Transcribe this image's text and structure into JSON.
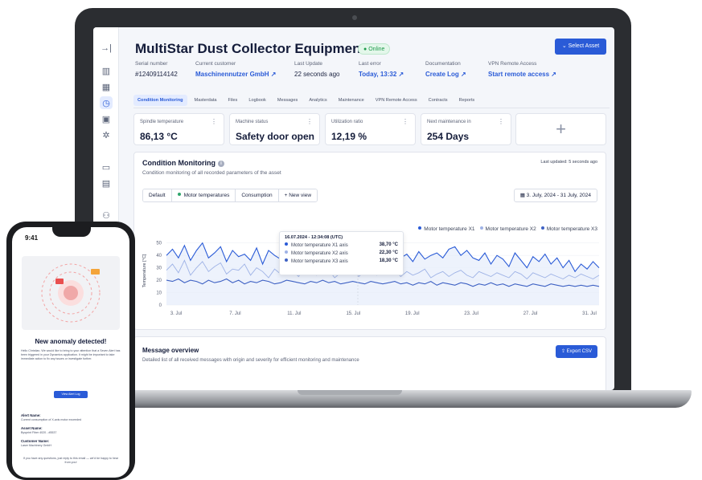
{
  "app": {
    "title": "MultiStar Dust Collector Equipment",
    "status_badge": "Online",
    "select_asset_label": "Select Asset",
    "colors": {
      "accent": "#2a5bd7",
      "online": "#1f9a4c",
      "series1": "#2a5bd7",
      "series2": "#9fb3e6",
      "series3": "#3f62c4"
    }
  },
  "sidebar": {
    "icons": [
      "collapse-icon",
      "dashboard-icon",
      "factory-icon",
      "monitoring-icon",
      "device-icon",
      "settings-icon",
      "folder-icon",
      "document-icon",
      "users-icon"
    ]
  },
  "meta": [
    {
      "label": "Serial number",
      "value": "#12409114142",
      "link": false
    },
    {
      "label": "Current customer",
      "value": "Maschinennutzer GmbH ↗",
      "link": true
    },
    {
      "label": "Last Update",
      "value": "22 seconds ago",
      "link": false
    },
    {
      "label": "Last error",
      "value": "Today, 13:32 ↗",
      "link": true
    },
    {
      "label": "Documentation",
      "value": "Create Log ↗",
      "link": true
    },
    {
      "label": "VPN Remote Access",
      "value": "Start remote access ↗",
      "link": true
    }
  ],
  "tabs": [
    "Condition Monitoring",
    "Masterdata",
    "Files",
    "Logbook",
    "Messages",
    "Analytics",
    "Maintenance",
    "VPN Remote Access",
    "Contracts",
    "Reports"
  ],
  "kpis": [
    {
      "label": "Spindle temperature",
      "value": "86,13 °C"
    },
    {
      "label": "Machine status",
      "value": "Safety door open"
    },
    {
      "label": "Utilization ratio",
      "value": "12,19 %"
    },
    {
      "label": "Next maintenance in",
      "value": "254 Days"
    }
  ],
  "kpi_add_label": "+",
  "condition": {
    "title": "Condition Monitoring",
    "subtitle": "Condition monitoring of all recorded parameters of the asset",
    "last_updated": "Last updated: 5 seconds ago",
    "views": [
      "Default",
      "Motor temperatures",
      "Consumption",
      "+ New view"
    ],
    "date_range": "3. July, 2024 - 31 July, 2024"
  },
  "tooltip": {
    "title": "16.07.2024 - 12:34:08 (UTC)",
    "rows": [
      {
        "label": "Motor temperature X1 axis",
        "value": "38,70 °C"
      },
      {
        "label": "Motor temperature X2 axis",
        "value": "22,30 °C"
      },
      {
        "label": "Motor temperature X3 axis",
        "value": "18,30 °C"
      }
    ]
  },
  "chart_data": {
    "type": "line",
    "title": "",
    "xlabel": "",
    "ylabel": "Temperature [°C]",
    "ylim": [
      0,
      55
    ],
    "yticks": [
      0,
      10,
      20,
      30,
      40,
      50
    ],
    "xticks": [
      "3. Jul",
      "7. Jul",
      "11. Jul",
      "15. Jul",
      "19. Jul",
      "23. Jul",
      "27. Jul",
      "31. Jul"
    ],
    "legend_position": "top-right",
    "series": [
      {
        "name": "Motor temperature X1",
        "values": [
          40,
          45,
          38,
          48,
          36,
          44,
          50,
          38,
          42,
          47,
          35,
          44,
          39,
          41,
          36,
          46,
          33,
          44,
          40,
          37,
          42,
          38,
          44,
          36,
          41,
          37,
          45,
          39,
          42,
          36,
          44,
          38,
          40,
          43,
          37,
          42,
          39,
          36,
          45,
          38,
          41,
          35,
          43,
          37,
          40,
          42,
          38,
          45,
          47,
          40,
          44,
          38,
          36,
          42,
          33,
          40,
          37,
          31,
          42,
          36,
          30,
          39,
          35,
          41,
          33,
          38,
          30,
          36,
          27,
          33,
          29,
          35,
          30
        ]
      },
      {
        "name": "Motor temperature X2",
        "values": [
          28,
          33,
          26,
          36,
          24,
          30,
          35,
          27,
          31,
          34,
          25,
          29,
          28,
          33,
          24,
          30,
          27,
          22,
          29,
          25,
          31,
          27,
          23,
          30,
          26,
          24,
          29,
          28,
          22,
          26,
          25,
          30,
          23,
          27,
          29,
          24,
          26,
          25,
          28,
          23,
          27,
          24,
          26,
          29,
          22,
          25,
          27,
          23,
          26,
          28,
          24,
          22,
          27,
          25,
          23,
          26,
          24,
          22,
          27,
          25,
          21,
          26,
          24,
          22,
          25,
          23,
          21,
          24,
          22,
          25,
          23,
          21,
          24
        ]
      },
      {
        "name": "Motor temperature X3",
        "values": [
          20,
          19,
          21,
          18,
          20,
          19,
          17,
          20,
          18,
          19,
          21,
          18,
          20,
          17,
          19,
          18,
          20,
          19,
          17,
          18,
          20,
          19,
          18,
          17,
          19,
          18,
          20,
          18,
          19,
          17,
          18,
          19,
          18,
          17,
          19,
          18,
          17,
          18,
          19,
          17,
          18,
          16,
          18,
          17,
          19,
          16,
          18,
          17,
          16,
          18,
          17,
          15,
          17,
          16,
          18,
          16,
          17,
          15,
          17,
          16,
          15,
          17,
          16,
          15,
          17,
          16,
          15,
          16,
          15,
          16,
          15,
          16,
          15
        ]
      }
    ]
  },
  "messages": {
    "title": "Message overview",
    "subtitle": "Detailed list of all received messages with origin and severity for efficient monitoring and maintenance",
    "export_label": "Export CSV"
  },
  "phone": {
    "time": "9:41",
    "title": "New anomaly detected!",
    "body": "Hello Christian, We would like to bring to your attention that a Seven Alert has been triggered in your Dynamics application. It might be important to take immediate action to fix any issues or investigate further.",
    "button": "View Alert Log",
    "alert_name_label": "Alert Name:",
    "alert_name_value": "Current consumption of X-axis motor exceeded",
    "asset_name_label": "Asset Name:",
    "asset_name_value": "Bysprint Fiber 4020 - #5537",
    "customer_name_label": "Customer Name:",
    "customer_name_value": "Laser Machinery GmbH",
    "footer": "If you have any questions, just reply to this email — we'd be happy to hear from you!"
  }
}
